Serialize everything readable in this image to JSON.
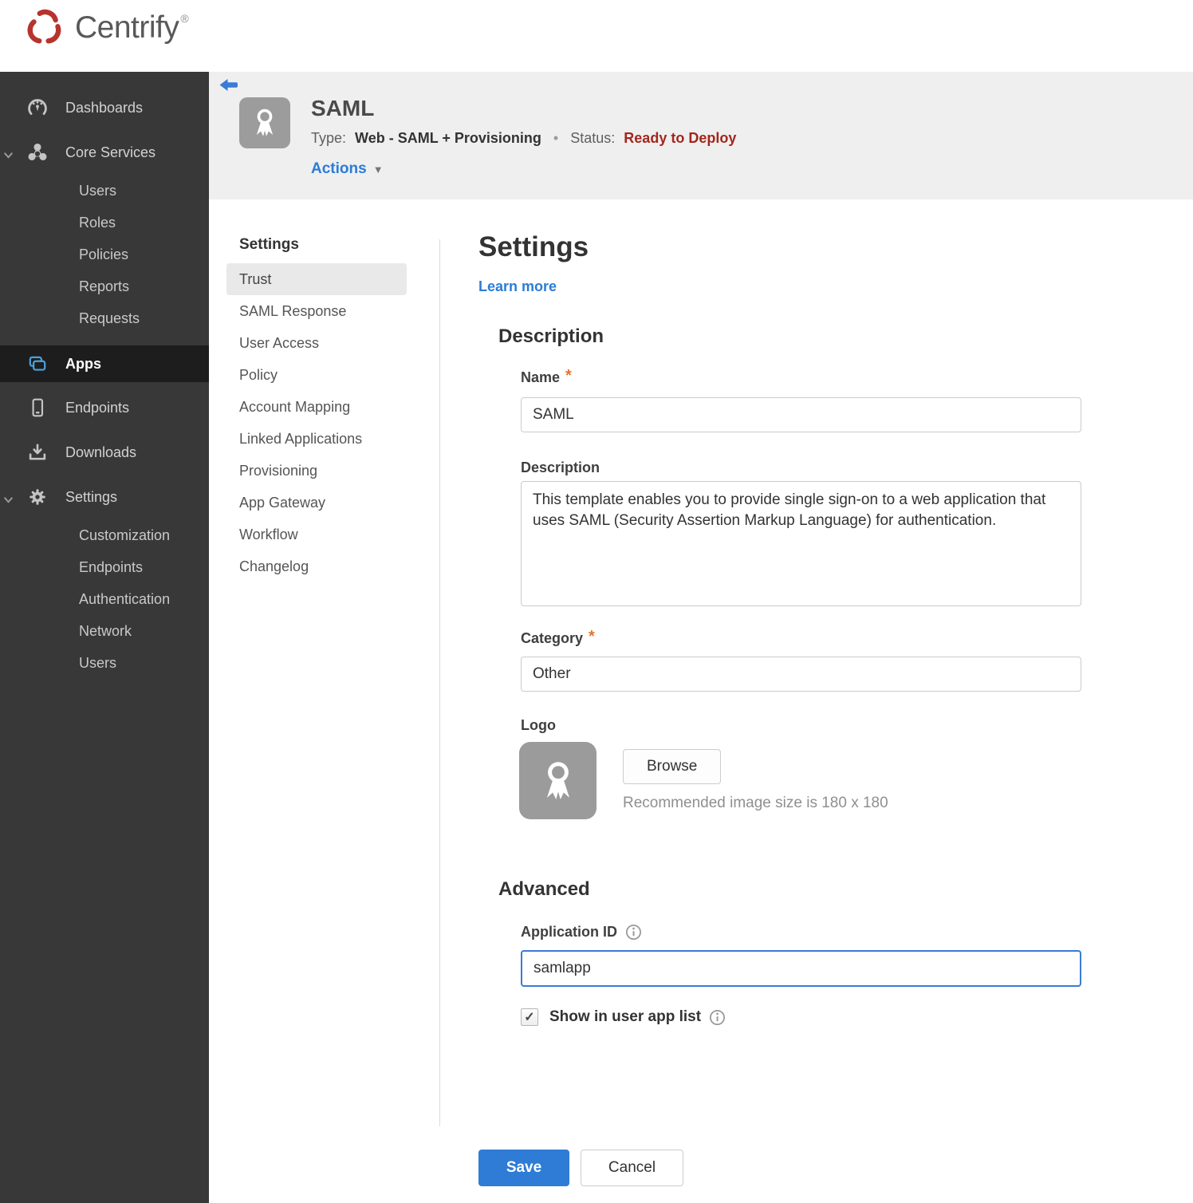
{
  "brand": {
    "name": "Centrify",
    "registered": "®"
  },
  "icons": {
    "caret_down": "▼",
    "separator_dot": "•",
    "check": "✓",
    "asterisk": "*"
  },
  "colors": {
    "brand_red": "#b7332d",
    "link_blue": "#2b7cd6",
    "save_blue": "#2e7cd6",
    "status_red": "#a3261d",
    "required_orange": "#e8732a",
    "sidebar_bg": "#383838",
    "sidebar_active_bg": "#1d1d1d",
    "header_bg": "#efefef"
  },
  "sidebar": {
    "dashboards": "Dashboards",
    "core_services": "Core Services",
    "core_children": {
      "users": "Users",
      "roles": "Roles",
      "policies": "Policies",
      "reports": "Reports",
      "requests": "Requests"
    },
    "apps": "Apps",
    "endpoints": "Endpoints",
    "downloads": "Downloads",
    "settings": "Settings",
    "settings_children": {
      "customization": "Customization",
      "endpoints": "Endpoints",
      "authentication": "Authentication",
      "network": "Network",
      "users": "Users"
    }
  },
  "header": {
    "app_name": "SAML",
    "type_label": "Type:",
    "type_value": "Web - SAML + Provisioning",
    "status_label": "Status:",
    "status_value": "Ready to Deploy",
    "actions_label": "Actions"
  },
  "subnav": {
    "title": "Settings",
    "items": [
      "Trust",
      "SAML Response",
      "User Access",
      "Policy",
      "Account Mapping",
      "Linked Applications",
      "Provisioning",
      "App Gateway",
      "Workflow",
      "Changelog"
    ],
    "selected": "Trust"
  },
  "main": {
    "title": "Settings",
    "learn_more_label": "Learn more",
    "description": {
      "section_title": "Description",
      "name_label": "Name",
      "name_value": "SAML",
      "description_label": "Description",
      "description_value": "This template enables you to provide single sign-on to a web application that uses SAML (Security Assertion Markup Language) for authentication.",
      "category_label": "Category",
      "category_value": "Other",
      "logo_label": "Logo",
      "browse_label": "Browse",
      "recommended_text": "Recommended image size is 180 x 180"
    },
    "advanced": {
      "section_title": "Advanced",
      "application_id_label": "Application ID",
      "application_id_value": "samlapp",
      "show_in_user_app_list_label": "Show in user app list",
      "show_in_user_app_list_checked": true
    },
    "save_label": "Save",
    "cancel_label": "Cancel"
  }
}
